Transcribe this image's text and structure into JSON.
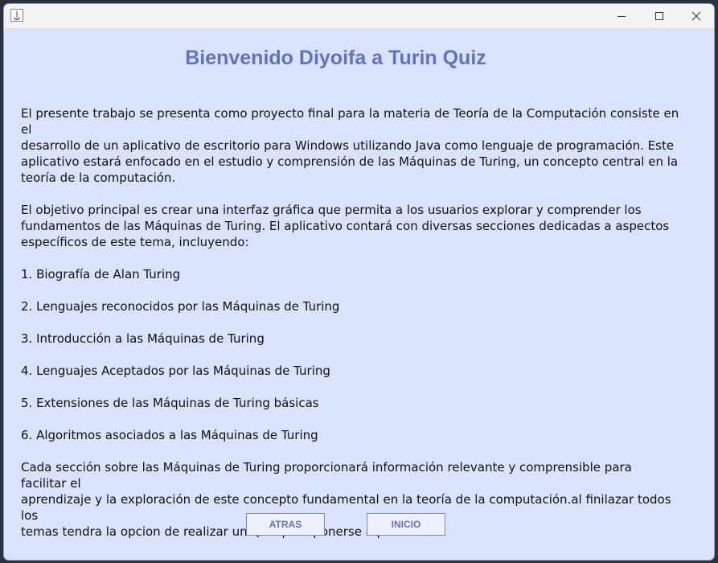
{
  "window": {
    "icon": "java-icon",
    "controls": {
      "minimize_icon": "minimize-icon",
      "maximize_icon": "maximize-icon",
      "close_icon": "close-icon"
    }
  },
  "main": {
    "heading": "Bienvenido Diyoifa a Turin Quiz",
    "intro": [
      "El presente trabajo se presenta como proyecto final para la materia de Teoría de la Computación consiste en el",
      "desarrollo de un aplicativo de escritorio para Windows utilizando Java como lenguaje de programación. Este",
      "aplicativo estará enfocado en el estudio y comprensión de las Máquinas de Turing, un concepto central en la",
      "teoría de la computación."
    ],
    "objective": [
      "El objetivo principal es crear una interfaz gráfica que permita a los usuarios explorar y comprender los",
      "fundamentos de las Máquinas de Turing. El aplicativo contará con diversas secciones dedicadas a aspectos",
      "específicos de este tema, incluyendo:"
    ],
    "sections": [
      "1. Biografía de Alan Turing",
      "2. Lenguajes reconocidos por las Máquinas de Turing",
      "3. Introducción a las Máquinas de Turing",
      "4. Lenguajes Aceptados por las Máquinas de Turing",
      "5. Extensiones de las Máquinas de Turing básicas",
      "6. Algoritmos asociados a las Máquinas de Turing"
    ],
    "closing": [
      "Cada sección sobre las Máquinas de Turing proporcionará información relevante y comprensible para facilitar el",
      "aprendizaje y la exploración de este concepto fundamental en la teoría de la computación.al finilazar todos los",
      "temas tendra la opcion de realizar un Quiz para ponerse a prueba."
    ]
  },
  "buttons": {
    "back_label": "ATRAS",
    "home_label": "INICIO"
  },
  "colors": {
    "background": "#dbe2fb",
    "accent": "#5f73c2"
  }
}
